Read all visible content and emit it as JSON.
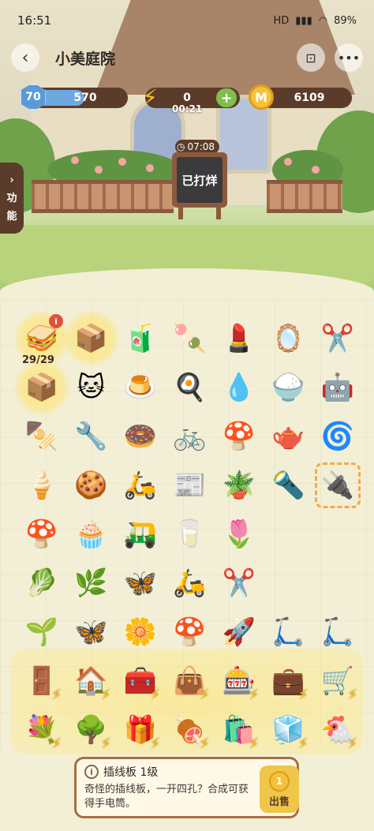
{
  "status_bar": {
    "time": "16:51",
    "net_label": "HD",
    "battery": "89%"
  },
  "nav": {
    "title": "小美庭院"
  },
  "resources": {
    "level": "70",
    "xp": "570",
    "xp_fill": 0.55,
    "energy": "0",
    "energy_timer": "00:21",
    "coins": "6109",
    "coin_letter": "M"
  },
  "sign": {
    "timer": "07:08",
    "text": "已打烊"
  },
  "side_tab": {
    "label_line1": "功",
    "label_line2": "能"
  },
  "board": {
    "stack_count": "29/29",
    "items": [
      {
        "name": "sandwich-box",
        "icon": "🥪",
        "glow": true,
        "badge": "i"
      },
      {
        "name": "cardboard-box",
        "icon": "📦",
        "glow": true
      },
      {
        "name": "orange-juice",
        "icon": "🧃"
      },
      {
        "name": "ice-pop",
        "icon": "🍡"
      },
      {
        "name": "lipstick",
        "icon": "💄"
      },
      {
        "name": "mirror",
        "icon": "🪞"
      },
      {
        "name": "eyelash-curler",
        "icon": "✂️"
      },
      {
        "name": "cardboard-box-2",
        "icon": "📦",
        "glow": true
      },
      {
        "name": "cat-bag",
        "icon": "🐱"
      },
      {
        "name": "pudding",
        "icon": "🍮"
      },
      {
        "name": "frying-pan",
        "icon": "🍳"
      },
      {
        "name": "water-drop",
        "icon": "💧"
      },
      {
        "name": "rice-cooker",
        "icon": "🍚"
      },
      {
        "name": "robot-vacuum",
        "icon": "🤖"
      },
      {
        "name": "kebab",
        "icon": "🍢"
      },
      {
        "name": "hair-dryer",
        "icon": "🔧"
      },
      {
        "name": "donut",
        "icon": "🍩"
      },
      {
        "name": "bicycle",
        "icon": "🚲"
      },
      {
        "name": "mushroom",
        "icon": "🍄"
      },
      {
        "name": "kettle",
        "icon": "🫖"
      },
      {
        "name": "desk-fan",
        "icon": "🌀"
      },
      {
        "name": "ice-cream-bar",
        "icon": "🍦"
      },
      {
        "name": "macaron",
        "icon": "🍪"
      },
      {
        "name": "scooter",
        "icon": "🛵"
      },
      {
        "name": "newspaper",
        "icon": "📰"
      },
      {
        "name": "potted-plant",
        "icon": "🪴"
      },
      {
        "name": "flashlight",
        "icon": "🔦"
      },
      {
        "name": "power-strip",
        "icon": "🔌",
        "selected": true
      },
      {
        "name": "purple-mushrooms",
        "icon": "🍄"
      },
      {
        "name": "cupcake",
        "icon": "🧁"
      },
      {
        "name": "tuk-tuk",
        "icon": "🛺"
      },
      {
        "name": "milk-bottles",
        "icon": "🥛"
      },
      {
        "name": "tulip-bouquet",
        "icon": "🌷"
      },
      null,
      null,
      {
        "name": "lettuce",
        "icon": "🥬"
      },
      {
        "name": "chard",
        "icon": "🌿"
      },
      {
        "name": "blue-butterfly",
        "icon": "🦋"
      },
      {
        "name": "red-scooter",
        "icon": "🛵"
      },
      {
        "name": "scissors-token",
        "icon": "✂️"
      },
      null,
      null,
      {
        "name": "leaf-sprout",
        "icon": "🌱"
      },
      {
        "name": "white-butterfly",
        "icon": "🦋"
      },
      {
        "name": "cotton-flower",
        "icon": "🌼"
      },
      {
        "name": "purple-mushroom-cluster",
        "icon": "🍄"
      },
      {
        "name": "rocket-token",
        "icon": "🚀"
      },
      {
        "name": "kick-scooter",
        "icon": "🛴"
      },
      {
        "name": "kick-scooter-2",
        "icon": "🛴"
      },
      {
        "name": "wardrobe-generator",
        "icon": "🚪",
        "bolt": true
      },
      {
        "name": "greenhouse-generator",
        "icon": "🏠",
        "bolt": true
      },
      {
        "name": "toolbox-generator",
        "icon": "🧰",
        "bolt": true
      },
      {
        "name": "handbag-generator",
        "icon": "👜",
        "bolt": true
      },
      {
        "name": "claw-machine-generator",
        "icon": "🎰",
        "bolt": true
      },
      {
        "name": "treasure-chest-generator",
        "icon": "💼",
        "bolt": true
      },
      {
        "name": "cart-generator",
        "icon": "🛒",
        "bolt": true
      },
      {
        "name": "flower-stand-generator",
        "icon": "💐",
        "bolt": true
      },
      {
        "name": "tree-generator",
        "icon": "🌳",
        "bolt": true
      },
      {
        "name": "pink-chest-generator",
        "icon": "🎁",
        "bolt": true
      },
      {
        "name": "grill-generator",
        "icon": "🍖",
        "bolt": true
      },
      {
        "name": "shopping-cart-generator",
        "icon": "🛍️",
        "bolt": true
      },
      {
        "name": "vending-machine-generator",
        "icon": "🧊",
        "bolt": true
      },
      {
        "name": "chicken-generator",
        "icon": "🐔",
        "bolt": true
      }
    ]
  },
  "info_panel": {
    "icon_letter": "i",
    "title": "插线板 1级",
    "description": "奇怪的插线板，一开四孔？合成可获得手电筒。",
    "sell_value": "1",
    "sell_label": "出售"
  }
}
